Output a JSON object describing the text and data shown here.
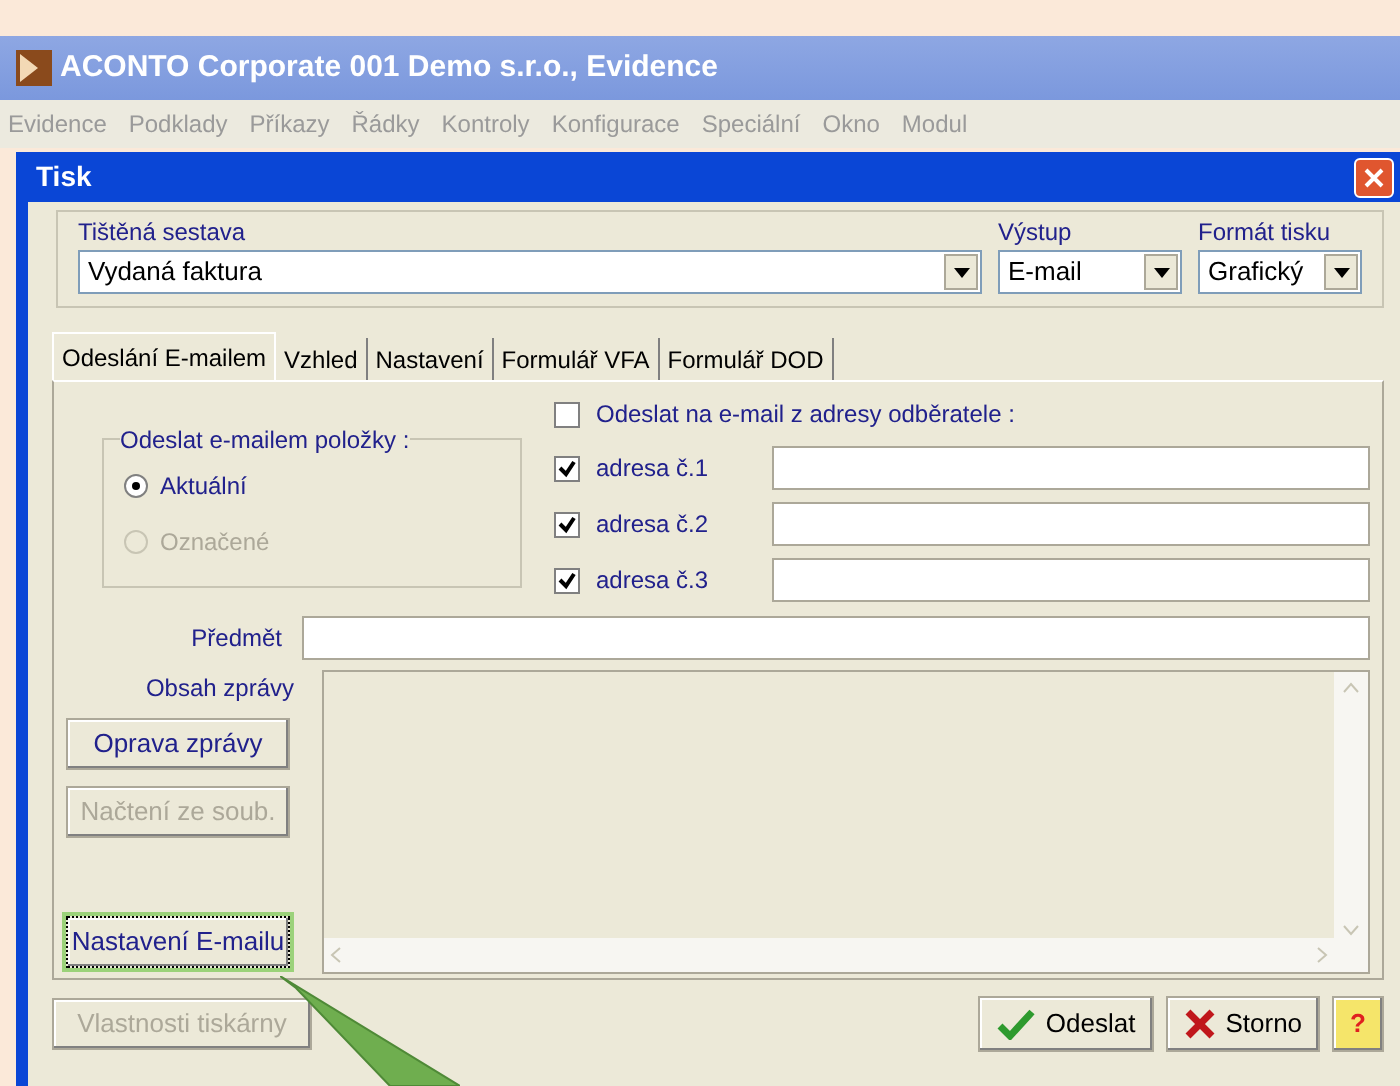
{
  "app": {
    "title": "ACONTO Corporate 001 Demo s.r.o., Evidence"
  },
  "menu": [
    "Evidence",
    "Podklady",
    "Příkazy",
    "Řádky",
    "Kontroly",
    "Konfigurace",
    "Speciální",
    "Okno",
    "Modul"
  ],
  "dialog": {
    "title": "Tisk"
  },
  "report": {
    "label": "Tištěná sestava",
    "value": "Vydaná faktura"
  },
  "output": {
    "label": "Výstup",
    "value": "E-mail"
  },
  "format": {
    "label": "Formát tisku",
    "value": "Grafický"
  },
  "tabs": [
    {
      "label": "Odeslání E-mailem",
      "selected": true
    },
    {
      "label": "Vzhled",
      "selected": false
    },
    {
      "label": "Nastavení",
      "selected": false
    },
    {
      "label": "Formulář VFA",
      "selected": false
    },
    {
      "label": "Formulář DOD",
      "selected": false
    }
  ],
  "group": {
    "title": "Odeslat e-mailem položky :",
    "options": [
      {
        "label": "Aktuální",
        "selected": true,
        "disabled": false
      },
      {
        "label": "Označené",
        "selected": false,
        "disabled": true
      }
    ]
  },
  "customer_address": {
    "label": "Odeslat na e-mail z adresy odběratele :",
    "checked": false
  },
  "addresses": [
    {
      "label": "adresa č.1",
      "checked": true
    },
    {
      "label": "adresa č.2",
      "checked": true
    },
    {
      "label": "adresa č.3",
      "checked": true
    }
  ],
  "subject": {
    "label": "Předmět"
  },
  "message": {
    "label": "Obsah zprávy"
  },
  "side_buttons": [
    {
      "label": "Oprava zprávy",
      "disabled": false,
      "focused": false
    },
    {
      "label": "Načtení ze soub.",
      "disabled": true,
      "focused": false
    },
    {
      "label": "Nastavení E-mailu",
      "disabled": false,
      "focused": true
    }
  ],
  "printer_button": {
    "label": "Vlastnosti tiskárny",
    "disabled": true
  },
  "actions": [
    {
      "label": "Odeslat",
      "kind": "send"
    },
    {
      "label": "Storno",
      "kind": "cancel"
    },
    {
      "label": "?",
      "kind": "help"
    }
  ]
}
